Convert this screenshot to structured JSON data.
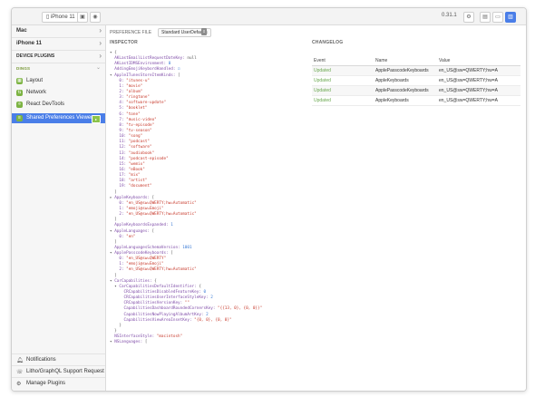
{
  "titlebar": {
    "device_selector": "iPhone 11",
    "version": "0.31.1"
  },
  "sidebar": {
    "groups": [
      {
        "label": "Mac"
      },
      {
        "label": "iPhone 11"
      }
    ],
    "device_plugins_label": "DEVICE PLUGINS",
    "section_label": "DINGS",
    "plugins": [
      {
        "label": "Layout",
        "icon": "layout-icon"
      },
      {
        "label": "Network",
        "icon": "network-icon"
      },
      {
        "label": "React DevTools",
        "icon": "react-devtools-icon"
      },
      {
        "label": "Shared Preferences Viewer",
        "icon": "shared-preferences-icon",
        "active": true
      }
    ],
    "bottom": [
      {
        "label": "Notifications",
        "icon": "bell-icon"
      },
      {
        "label": "Litho/GraphQL Support Request",
        "icon": "support-icon"
      },
      {
        "label": "Manage Plugins",
        "icon": "gear-icon"
      }
    ]
  },
  "main": {
    "preference_file_label": "PREFERENCE FILE",
    "preference_file_value": "Standard UserDefaults",
    "inspector_title": "INSPECTOR",
    "changelog_title": "CHANGELOG"
  },
  "inspector_lines": [
    [
      [
        "p",
        "▾ {"
      ]
    ],
    [
      [
        "p",
        "  "
      ],
      [
        "k",
        "AKLastEmailListRequestDateKey:"
      ],
      [
        "p",
        " null"
      ]
    ],
    [
      [
        "p",
        "  "
      ],
      [
        "k",
        "AKLastIDMSEnvironment:"
      ],
      [
        "n",
        " 0"
      ]
    ],
    [
      [
        "p",
        "  "
      ],
      [
        "k",
        "AddingEmojiKeybordHandled:"
      ],
      [
        "n",
        " ☑"
      ]
    ],
    [
      [
        "p",
        "▾ "
      ],
      [
        "k",
        "AppleITunesStoreItemKinds:"
      ],
      [
        "p",
        " ["
      ]
    ],
    [
      [
        "p",
        "    "
      ],
      [
        "k",
        "0:"
      ],
      [
        "s",
        " \"itunes-u\""
      ]
    ],
    [
      [
        "p",
        "    "
      ],
      [
        "k",
        "1:"
      ],
      [
        "s",
        " \"movie\""
      ]
    ],
    [
      [
        "p",
        "    "
      ],
      [
        "k",
        "2:"
      ],
      [
        "s",
        " \"album\""
      ]
    ],
    [
      [
        "p",
        "    "
      ],
      [
        "k",
        "3:"
      ],
      [
        "s",
        " \"ringtone\""
      ]
    ],
    [
      [
        "p",
        "    "
      ],
      [
        "k",
        "4:"
      ],
      [
        "s",
        " \"software-update\""
      ]
    ],
    [
      [
        "p",
        "    "
      ],
      [
        "k",
        "5:"
      ],
      [
        "s",
        " \"booklet\""
      ]
    ],
    [
      [
        "p",
        "    "
      ],
      [
        "k",
        "6:"
      ],
      [
        "s",
        " \"tone\""
      ]
    ],
    [
      [
        "p",
        "    "
      ],
      [
        "k",
        "7:"
      ],
      [
        "s",
        " \"music-video\""
      ]
    ],
    [
      [
        "p",
        "    "
      ],
      [
        "k",
        "8:"
      ],
      [
        "s",
        " \"tv-episode\""
      ]
    ],
    [
      [
        "p",
        "    "
      ],
      [
        "k",
        "9:"
      ],
      [
        "s",
        " \"tv-season\""
      ]
    ],
    [
      [
        "p",
        "    "
      ],
      [
        "k",
        "10:"
      ],
      [
        "s",
        " \"song\""
      ]
    ],
    [
      [
        "p",
        "    "
      ],
      [
        "k",
        "11:"
      ],
      [
        "s",
        " \"podcast\""
      ]
    ],
    [
      [
        "p",
        "    "
      ],
      [
        "k",
        "12:"
      ],
      [
        "s",
        " \"software\""
      ]
    ],
    [
      [
        "p",
        "    "
      ],
      [
        "k",
        "13:"
      ],
      [
        "s",
        " \"audiobook\""
      ]
    ],
    [
      [
        "p",
        "    "
      ],
      [
        "k",
        "14:"
      ],
      [
        "s",
        " \"podcast-episode\""
      ]
    ],
    [
      [
        "p",
        "    "
      ],
      [
        "k",
        "15:"
      ],
      [
        "s",
        " \"wemix\""
      ]
    ],
    [
      [
        "p",
        "    "
      ],
      [
        "k",
        "16:"
      ],
      [
        "s",
        " \"eBook\""
      ]
    ],
    [
      [
        "p",
        "    "
      ],
      [
        "k",
        "17:"
      ],
      [
        "s",
        " \"mix\""
      ]
    ],
    [
      [
        "p",
        "    "
      ],
      [
        "k",
        "18:"
      ],
      [
        "s",
        " \"artist\""
      ]
    ],
    [
      [
        "p",
        "    "
      ],
      [
        "k",
        "19:"
      ],
      [
        "s",
        " \"document\""
      ]
    ],
    [
      [
        "p",
        "  ]"
      ]
    ],
    [
      [
        "p",
        "▸ "
      ],
      [
        "k",
        "AppleKeyboards:"
      ],
      [
        "p",
        " ["
      ]
    ],
    [
      [
        "p",
        "    "
      ],
      [
        "k",
        "0:"
      ],
      [
        "s",
        " \"en_US@sw=QWERTY;hw=Automatic\""
      ]
    ],
    [
      [
        "p",
        "    "
      ],
      [
        "k",
        "1:"
      ],
      [
        "s",
        " \"emoji@sw=Emoji\""
      ]
    ],
    [
      [
        "p",
        "    "
      ],
      [
        "k",
        "2:"
      ],
      [
        "s",
        " \"en_US@sw=QWERTY;hw=Automatic\""
      ]
    ],
    [
      [
        "p",
        "  ]"
      ]
    ],
    [
      [
        "p",
        "  "
      ],
      [
        "k",
        "AppleKeyboardsExpanded:"
      ],
      [
        "n",
        " 1"
      ]
    ],
    [
      [
        "p",
        "▾ "
      ],
      [
        "k",
        "AppleLanguages:"
      ],
      [
        "p",
        " ["
      ]
    ],
    [
      [
        "p",
        "    "
      ],
      [
        "k",
        "0:"
      ],
      [
        "s",
        " \"en\""
      ]
    ],
    [
      [
        "p",
        "  ]"
      ]
    ],
    [
      [
        "p",
        "  "
      ],
      [
        "k",
        "AppleLanguagesSchemaVersion:"
      ],
      [
        "n",
        " 1001"
      ]
    ],
    [
      [
        "p",
        "▾ "
      ],
      [
        "k",
        "ApplePasscodeKeyboards:"
      ],
      [
        "p",
        " ["
      ]
    ],
    [
      [
        "p",
        "    "
      ],
      [
        "k",
        "0:"
      ],
      [
        "s",
        " \"en_US@sw=QWERTY\""
      ]
    ],
    [
      [
        "p",
        "    "
      ],
      [
        "k",
        "1:"
      ],
      [
        "s",
        " \"emoji@sw=Emoji\""
      ]
    ],
    [
      [
        "p",
        "    "
      ],
      [
        "k",
        "2:"
      ],
      [
        "s",
        " \"en_US@sw=QWERTY;hw=Automatic\""
      ]
    ],
    [
      [
        "p",
        "  ]"
      ]
    ],
    [
      [
        "p",
        "▾ "
      ],
      [
        "k",
        "CarCapabilities:"
      ],
      [
        "p",
        " {"
      ]
    ],
    [
      [
        "p",
        "  ▾ "
      ],
      [
        "k",
        "CarCapabilitiesDefaultIdentifier:"
      ],
      [
        "p",
        " {"
      ]
    ],
    [
      [
        "p",
        "      "
      ],
      [
        "k",
        "CRCapabilitiesDisabledFeatureKey:"
      ],
      [
        "n",
        " 0"
      ]
    ],
    [
      [
        "p",
        "      "
      ],
      [
        "k",
        "CRCapabilitiesUserInterfaceStyleKey:"
      ],
      [
        "n",
        " 2"
      ]
    ],
    [
      [
        "p",
        "      "
      ],
      [
        "k",
        "CRCapabilitiesVersionKey:"
      ],
      [
        "s",
        " \"\""
      ]
    ],
    [
      [
        "p",
        "      "
      ],
      [
        "k",
        "CapabilitiesDashboardRoundedCornersKey:"
      ],
      [
        "s",
        " \"{{13, 0}, {0, 0}}\""
      ]
    ],
    [
      [
        "p",
        "      "
      ],
      [
        "k",
        "CapabilitiesNowPlayingAlbumArtKey:"
      ],
      [
        "n",
        " 2"
      ]
    ],
    [
      [
        "p",
        "      "
      ],
      [
        "k",
        "CapabilitiesViewAreaInsetKey:"
      ],
      [
        "s",
        " \"{0, 0}, {0, 0}\""
      ]
    ],
    [
      [
        "p",
        "    }"
      ]
    ],
    [
      [
        "p",
        "  }"
      ]
    ],
    [
      [
        "p",
        "  "
      ],
      [
        "k",
        "NSInterfaceStyle:"
      ],
      [
        "s",
        " \"macintosh\""
      ]
    ],
    [
      [
        "p",
        "▾ "
      ],
      [
        "k",
        "NSLanguages:"
      ],
      [
        "p",
        " ["
      ]
    ]
  ],
  "changelog": {
    "headers": [
      "Event",
      "Name",
      "Value"
    ],
    "rows": [
      {
        "event": "Updated",
        "name": "ApplePasscodeKeyboards",
        "value": "en_US@sw=QWERTY;hw=A"
      },
      {
        "event": "Updated",
        "name": "AppleKeyboards",
        "value": "en_US@sw=QWERTY;hw=A"
      },
      {
        "event": "Updated",
        "name": "ApplePasscodeKeyboards",
        "value": "en_US@sw=QWERTY;hw=A"
      },
      {
        "event": "Updated",
        "name": "AppleKeyboards",
        "value": "en_US@sw=QWERTY;hw=A"
      }
    ]
  }
}
